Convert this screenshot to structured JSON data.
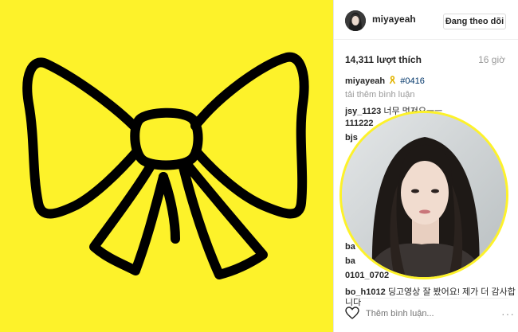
{
  "header": {
    "username": "miyayeah",
    "follow_label": "Đang theo dõi"
  },
  "post": {
    "likes": "14,311 lượt thích",
    "time": "16 giờ",
    "caption_user": "miyayeah",
    "caption_tag": "#0416",
    "load_more": "tải thêm bình luận",
    "comments": [
      {
        "user": "jsy_1123",
        "text": "너무 멋져요ㅡㅡ"
      },
      {
        "user": "111222",
        "text": ""
      },
      {
        "user": "bjs",
        "text": ""
      },
      {
        "user": "ba",
        "text": ""
      },
      {
        "user": "ba",
        "text": ""
      },
      {
        "user": "0101_0702",
        "text": ""
      },
      {
        "user": "bo_h1012",
        "text": "딩고영상 잘 봤어요! 제가 더 감사합"
      },
      {
        "user": "",
        "text": "니다"
      }
    ]
  },
  "footer": {
    "comment_placeholder": "Thêm bình luận...",
    "more_label": "···"
  },
  "icons": {
    "ribbon": "yellow-ribbon-icon",
    "heart": "heart-icon",
    "more": "more-options-icon"
  },
  "colors": {
    "image_background": "#fdf22a",
    "ribbon_stroke": "#000000",
    "tag_link": "#003569"
  }
}
